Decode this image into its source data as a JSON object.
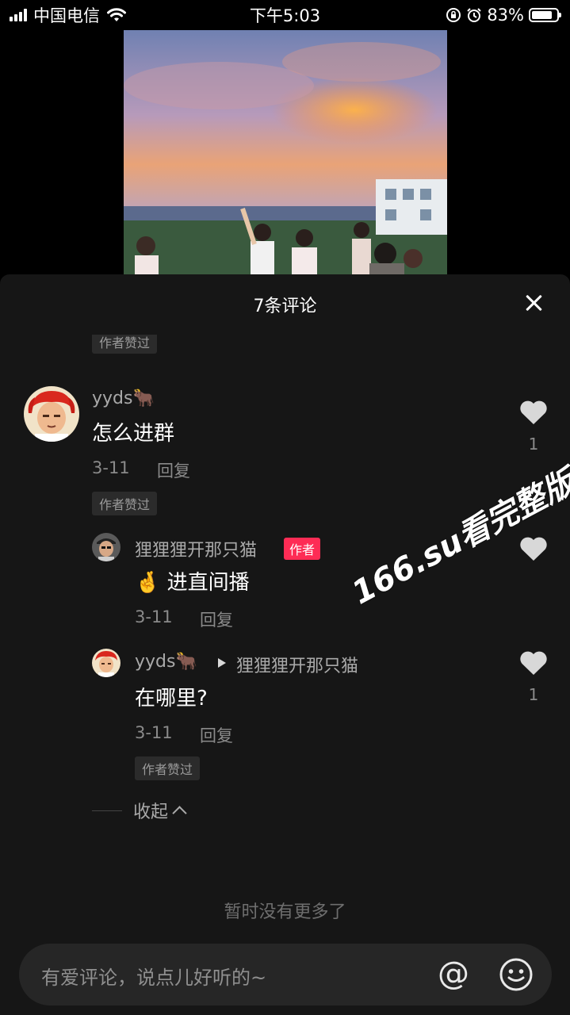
{
  "status_bar": {
    "carrier": "中国电信",
    "time": "下午5:03",
    "battery_text": "83%",
    "battery_level": 0.83
  },
  "panel": {
    "title": "7条评论"
  },
  "tags": {
    "author_liked": "作者赞过"
  },
  "comments": [
    {
      "username": "yyds🐂",
      "text": "怎么进群",
      "date": "3-11",
      "reply_label": "回复",
      "likes": "1"
    },
    {
      "username": "狸狸狸开那只猫",
      "badge": "作者",
      "text": "🤞 进直间播",
      "date": "3-11",
      "reply_label": "回复"
    },
    {
      "username": "yyds🐂",
      "reply_to": "狸狸狸开那只猫",
      "text": "在哪里?",
      "date": "3-11",
      "reply_label": "回复",
      "likes": "1"
    }
  ],
  "collapse_label": "收起",
  "no_more_text": "暂时没有更多了",
  "watermark": "166.su看完整版",
  "input": {
    "placeholder": "有爱评论，说点儿好听的~",
    "at_symbol": "@"
  },
  "icons": {
    "signal": "signal-icon",
    "wifi": "wifi-icon",
    "battery": "battery-icon",
    "close": "close-icon",
    "heart": "heart-icon",
    "emoji": "emoji-icon",
    "at": "at-icon"
  },
  "colors": {
    "panel_bg": "#161616",
    "author_badge": "#fe2c55",
    "muted_text": "#8a8a8a"
  }
}
